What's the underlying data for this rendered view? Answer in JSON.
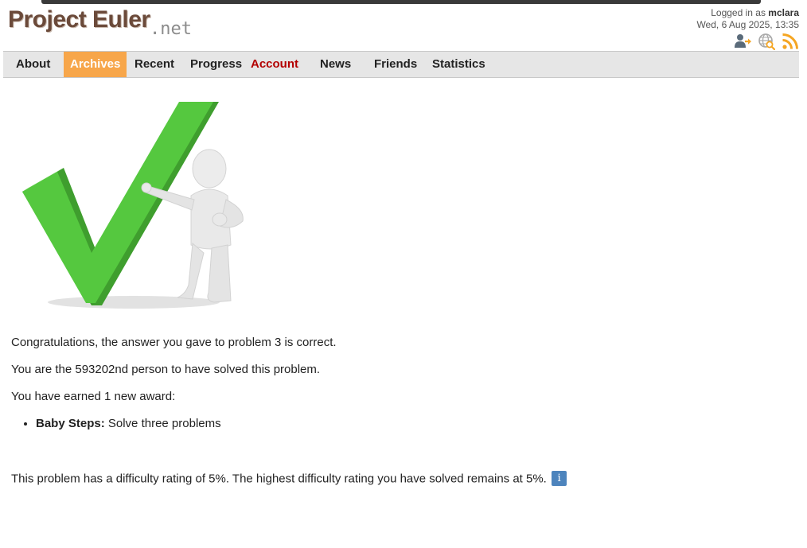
{
  "header": {
    "logo_main": "Project Euler",
    "logo_suffix": ".net",
    "logged_in_prefix": "Logged in as",
    "username": "mclara",
    "datetime": "Wed, 6 Aug 2025, 13:35",
    "icons": [
      "sign-out-icon",
      "world-search-icon",
      "rss-icon"
    ]
  },
  "nav": {
    "items": [
      {
        "label": "About"
      },
      {
        "label": "Archives",
        "active": true
      },
      {
        "label": "Recent"
      },
      {
        "label": "Progress"
      },
      {
        "label": "Account"
      },
      {
        "label": "News"
      },
      {
        "label": "Friends"
      },
      {
        "label": "Statistics"
      }
    ]
  },
  "colors": {
    "logo": "#6b4a3a",
    "nav_active": "#f7a64a",
    "account_link": "#b30000",
    "info_icon": "#4d84bd",
    "checkmark": "#4cc23a"
  },
  "result": {
    "correct_msg": "Congratulations, the answer you gave to problem 3 is correct.",
    "solver_msg": "You are the 593202nd person to have solved this problem.",
    "award_intro": "You have earned 1 new award:",
    "award_name": "Baby Steps:",
    "award_desc": "Solve three problems",
    "difficulty_msg": "This problem has a difficulty rating of 5%. The highest difficulty rating you have solved remains at 5%.",
    "info_icon_glyph": "i"
  }
}
